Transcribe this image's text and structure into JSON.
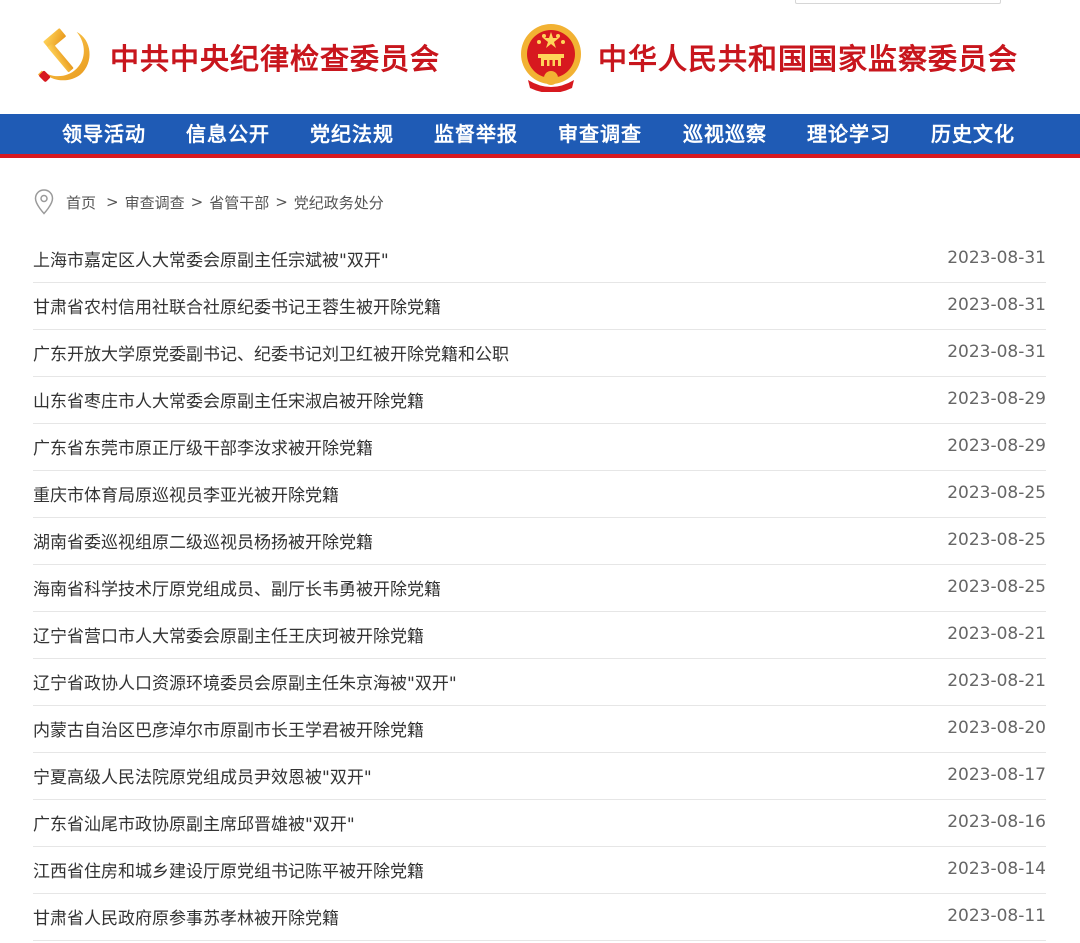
{
  "header": {
    "left_org": "中共中央纪律检查委员会",
    "right_org": "中华人民共和国国家监察委员会",
    "emblem_colors": {
      "party_red": "#d7191f",
      "gold": "#f2b233",
      "national_red": "#c8161d"
    }
  },
  "nav": {
    "background": "#1f5bb5",
    "accent": "#d7191f",
    "items": [
      {
        "label": "领导活动"
      },
      {
        "label": "信息公开"
      },
      {
        "label": "党纪法规"
      },
      {
        "label": "监督举报"
      },
      {
        "label": "审查调查"
      },
      {
        "label": "巡视巡察"
      },
      {
        "label": "理论学习"
      },
      {
        "label": "历史文化"
      }
    ]
  },
  "breadcrumb": {
    "icon": "location-pin-icon",
    "items": [
      {
        "label": "首页"
      },
      {
        "label": "审查调查"
      },
      {
        "label": "省管干部"
      },
      {
        "label": "党纪政务处分"
      }
    ],
    "separator": ">"
  },
  "articles": [
    {
      "title": "上海市嘉定区人大常委会原副主任宗斌被\"双开\"",
      "date": "2023-08-31"
    },
    {
      "title": "甘肃省农村信用社联合社原纪委书记王蓉生被开除党籍",
      "date": "2023-08-31"
    },
    {
      "title": "广东开放大学原党委副书记、纪委书记刘卫红被开除党籍和公职",
      "date": "2023-08-31"
    },
    {
      "title": "山东省枣庄市人大常委会原副主任宋淑启被开除党籍",
      "date": "2023-08-29"
    },
    {
      "title": "广东省东莞市原正厅级干部李汝求被开除党籍",
      "date": "2023-08-29"
    },
    {
      "title": "重庆市体育局原巡视员李亚光被开除党籍",
      "date": "2023-08-25"
    },
    {
      "title": "湖南省委巡视组原二级巡视员杨扬被开除党籍",
      "date": "2023-08-25"
    },
    {
      "title": "海南省科学技术厅原党组成员、副厅长韦勇被开除党籍",
      "date": "2023-08-25"
    },
    {
      "title": "辽宁省营口市人大常委会原副主任王庆珂被开除党籍",
      "date": "2023-08-21"
    },
    {
      "title": "辽宁省政协人口资源环境委员会原副主任朱京海被\"双开\"",
      "date": "2023-08-21"
    },
    {
      "title": "内蒙古自治区巴彦淖尔市原副市长王学君被开除党籍",
      "date": "2023-08-20"
    },
    {
      "title": "宁夏高级人民法院原党组成员尹效恩被\"双开\"",
      "date": "2023-08-17"
    },
    {
      "title": "广东省汕尾市政协原副主席邱晋雄被\"双开\"",
      "date": "2023-08-16"
    },
    {
      "title": "江西省住房和城乡建设厅原党组书记陈平被开除党籍",
      "date": "2023-08-14"
    },
    {
      "title": "甘肃省人民政府原参事苏孝林被开除党籍",
      "date": "2023-08-11"
    }
  ]
}
